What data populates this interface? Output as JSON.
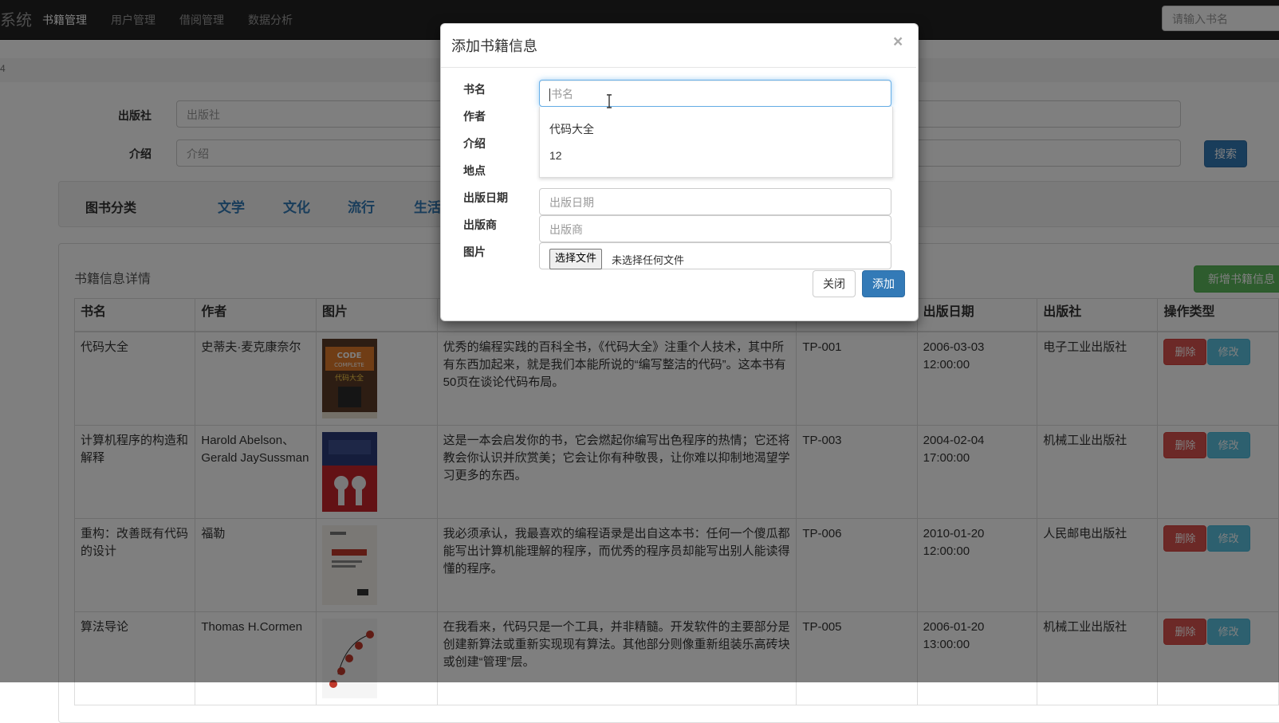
{
  "navbar": {
    "brand": "系统",
    "items": [
      "书籍管理",
      "用户管理",
      "借阅管理",
      "数据分析"
    ],
    "search_placeholder": "请输入书名"
  },
  "breadcrumb": {
    "text": "4"
  },
  "search_form": {
    "publisher_label": "出版社",
    "publisher_placeholder": "出版社",
    "intro_label": "介绍",
    "intro_placeholder": "介绍",
    "search_button": "搜索"
  },
  "categories": {
    "title": "图书分类",
    "items": [
      "文学",
      "文化",
      "流行",
      "生活"
    ]
  },
  "details": {
    "title": "书籍信息详情",
    "add_button": "新增书籍信息",
    "columns": [
      "书名",
      "作者",
      "图片",
      "",
      "",
      "出版日期",
      "出版社",
      "操作类型"
    ],
    "rows": [
      {
        "name": "代码大全",
        "author": "史蒂夫·麦克康奈尔",
        "intro": "优秀的编程实践的百科全书，《代码大全》注重个人技术，其中所有东西加起来，就是我们本能所说的“编写整洁的代码”。这本书有50页在谈论代码布局。",
        "code": "TP-001",
        "date": "2006-03-03 12:00:00",
        "publisher": "电子工业出版社",
        "cover_text": "CODE COMPLETE 代码大全"
      },
      {
        "name": "计算机程序的构造和解释",
        "author": "Harold Abelson、Gerald JaySussman",
        "intro": "这是一本会启发你的书，它会燃起你编写出色程序的热情；它还将教会你认识并欣赏美；它会让你有种敬畏，让你难以抑制地渴望学习更多的东西。",
        "code": "TP-003",
        "date": "2004-02-04 17:00:00",
        "publisher": "机械工业出版社",
        "cover_text": ""
      },
      {
        "name": "重构：改善既有代码的设计",
        "author": "福勒",
        "intro": "我必须承认，我最喜欢的编程语录是出自这本书：任何一个傻瓜都能写出计算机能理解的程序，而优秀的程序员却能写出别人能读得懂的程序。",
        "code": "TP-006",
        "date": "2010-01-20 12:00:00",
        "publisher": "人民邮电出版社",
        "cover_text": ""
      },
      {
        "name": "算法导论",
        "author": "Thomas H.Cormen",
        "intro": "在我看来，代码只是一个工具，并非精髓。开发软件的主要部分是创建新算法或重新实现现有算法。其他部分则像重新组装乐高砖块或创建“管理”层。",
        "code": "TP-005",
        "date": "2006-01-20 13:00:00",
        "publisher": "机械工业出版社",
        "cover_text": ""
      }
    ],
    "delete_label": "删除",
    "edit_label": "修改"
  },
  "modal": {
    "title": "添加书籍信息",
    "close_symbol": "×",
    "fields": {
      "name_label": "书名",
      "name_placeholder": "书名",
      "author_label": "作者",
      "intro_label": "介绍",
      "location_label": "地点",
      "date_label": "出版日期",
      "date_placeholder": "出版日期",
      "publisher_label": "出版商",
      "publisher_placeholder": "出版商",
      "image_label": "图片",
      "file_button": "选择文件",
      "file_status": "未选择任何文件"
    },
    "autocomplete": [
      "代码大全",
      "12"
    ],
    "close_button": "关闭",
    "add_button": "添加"
  },
  "colors": {
    "navbar": "#222222",
    "primary": "#337ab7",
    "success": "#5cb85c",
    "danger": "#d9534f",
    "info": "#5bc0de",
    "link": "#337ab7"
  }
}
